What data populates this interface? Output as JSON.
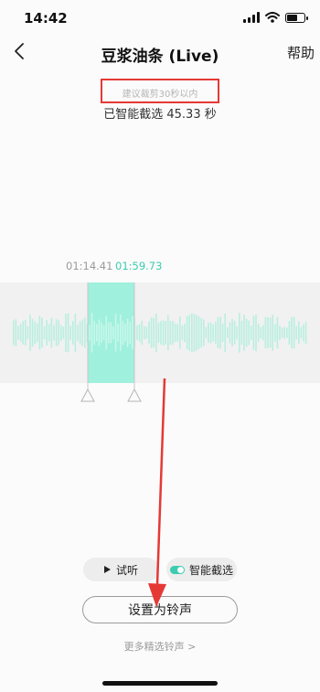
{
  "status_bar": {
    "time": "14:42",
    "battery_level": 0.65
  },
  "header": {
    "title": "豆浆油条 (Live)",
    "help": "帮助"
  },
  "hint": {
    "text": "建议裁剪30秒以内"
  },
  "selection": {
    "info": "已智能截选 45.33 秒",
    "start_time": "01:14.41",
    "end_time": "01:59.73"
  },
  "controls": {
    "audition_label": "试听",
    "smart_cut_label": "智能截选"
  },
  "actions": {
    "set_ringtone": "设置为铃声",
    "more_ringtones": "更多精选铃声 >"
  },
  "colors": {
    "accent": "#3ccbb0",
    "highlight_box": "#e53935",
    "selection_fill": "#9ff0dd",
    "waveform": "#b9efe0",
    "arrow": "#e53935"
  }
}
